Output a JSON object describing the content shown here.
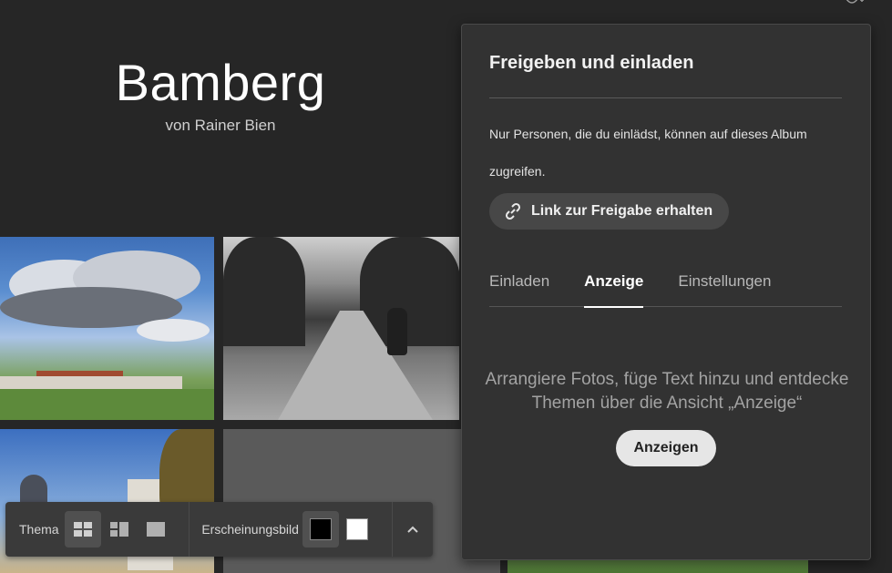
{
  "album": {
    "title": "Bamberg",
    "byline": "von Rainer Bien"
  },
  "toolbar": {
    "theme_label": "Thema",
    "appearance_label": "Erscheinungsbild",
    "layouts": [
      "grid-layout",
      "column-layout",
      "single-layout"
    ],
    "active_layout": "grid-layout",
    "background_options": [
      "#000000",
      "#ffffff"
    ],
    "active_background": "#000000"
  },
  "share_panel": {
    "title": "Freigeben und einladen",
    "description": "Nur Personen, die du einlädst, können auf dieses Album zugreifen.",
    "link_button": "Link zur Freigabe erhalten",
    "tabs": [
      "Einladen",
      "Anzeige",
      "Einstellungen"
    ],
    "active_tab": "Anzeige",
    "message": "Arrangiere Fotos, füge Text hinzu und entdecke Themen über die Ansicht „Anzeige“",
    "show_button": "Anzeigen"
  },
  "icons": {
    "top_right": "add-person-icon",
    "link": "link-icon",
    "chevron": "chevron-up-icon"
  }
}
